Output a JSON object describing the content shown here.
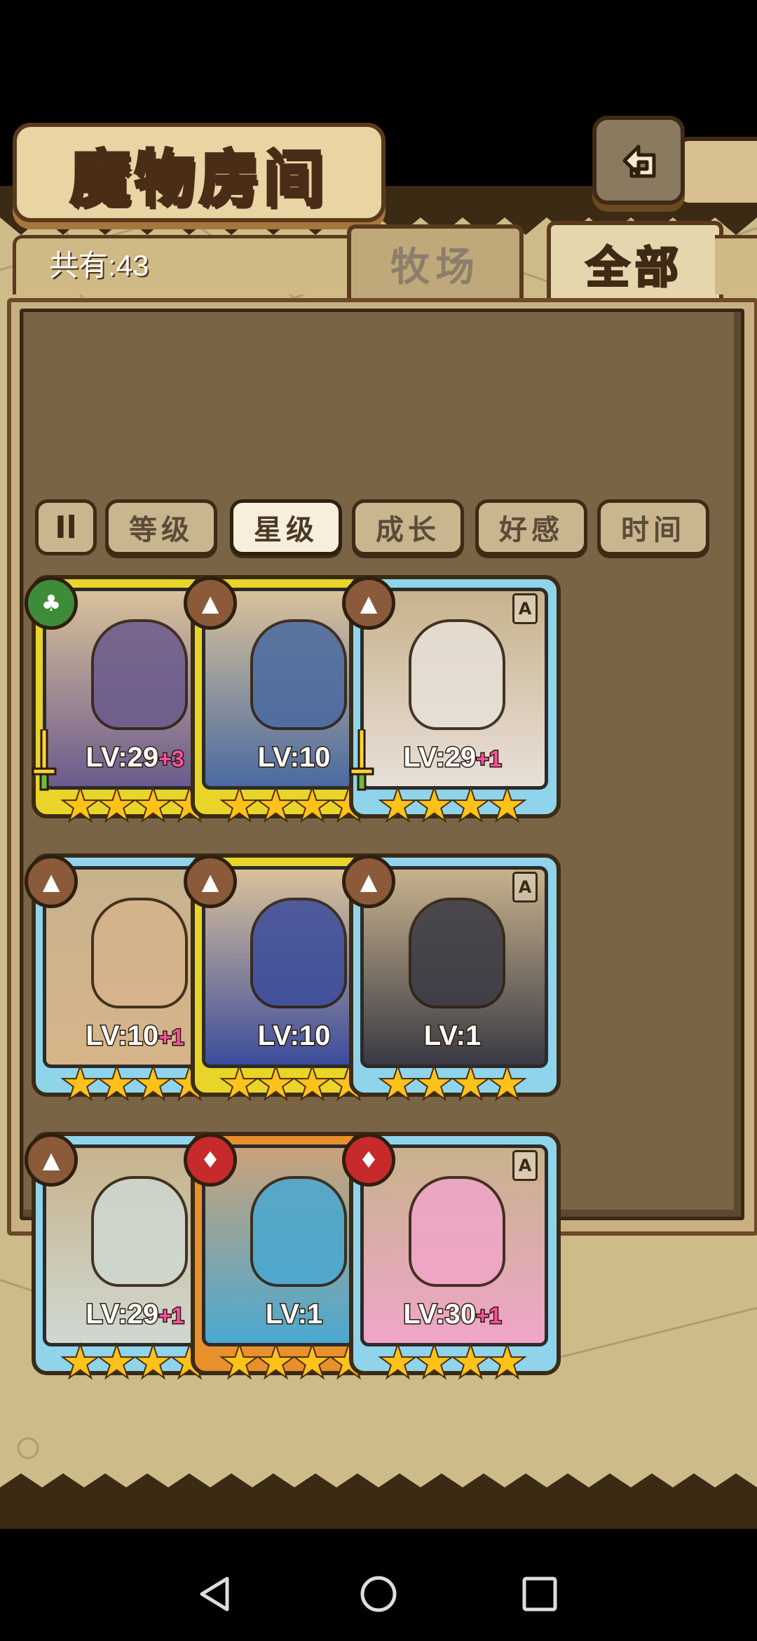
{
  "header": {
    "title": "魔物房间",
    "back_icon": "return-arrow-icon"
  },
  "summary": {
    "count_label": "共有:43"
  },
  "tabs": [
    {
      "label": "牧场",
      "active": false
    },
    {
      "label": "全部",
      "active": true
    }
  ],
  "sort": {
    "toggle_label": "Il",
    "options": [
      {
        "label": "等级",
        "active": false
      },
      {
        "label": "星级",
        "active": true
      },
      {
        "label": "成长",
        "active": false
      },
      {
        "label": "好感",
        "active": false
      },
      {
        "label": "时间",
        "active": false
      }
    ]
  },
  "monsters": [
    {
      "level": "LV:29",
      "bonus": "+3",
      "rarity": "S",
      "element": "grass",
      "stars": 4,
      "weapon": true
    },
    {
      "level": "LV:10",
      "bonus": "",
      "rarity": "S",
      "element": "earth",
      "stars": 4,
      "weapon": false
    },
    {
      "level": "LV:29",
      "bonus": "+1",
      "rarity": "A",
      "element": "earth",
      "stars": 4,
      "weapon": true
    },
    {
      "level": "LV:10",
      "bonus": "+1",
      "rarity": "A",
      "element": "earth",
      "stars": 4,
      "weapon": false
    },
    {
      "level": "LV:10",
      "bonus": "",
      "rarity": "S",
      "element": "earth",
      "stars": 4,
      "weapon": false
    },
    {
      "level": "LV:1",
      "bonus": "",
      "rarity": "A",
      "element": "earth",
      "stars": 4,
      "weapon": false
    },
    {
      "level": "LV:29",
      "bonus": "+1",
      "rarity": "A",
      "element": "earth",
      "stars": 4,
      "weapon": false
    },
    {
      "level": "LV:1",
      "bonus": "",
      "rarity": "B",
      "element": "fire",
      "stars": 4,
      "weapon": false
    },
    {
      "level": "LV:30",
      "bonus": "+1",
      "rarity": "A",
      "element": "fire",
      "stars": 4,
      "weapon": false
    }
  ],
  "colors": {
    "rarity_S": "#e9d42a",
    "rarity_A": "#8fd4ea",
    "rarity_B": "#e8902c",
    "panel_bg": "#cdbb8a",
    "frame_dark": "#3a2714",
    "star": "#ffc21a"
  },
  "navbar": {
    "back_icon": "nav-back-icon",
    "home_icon": "nav-home-icon",
    "recents_icon": "nav-recents-icon"
  }
}
